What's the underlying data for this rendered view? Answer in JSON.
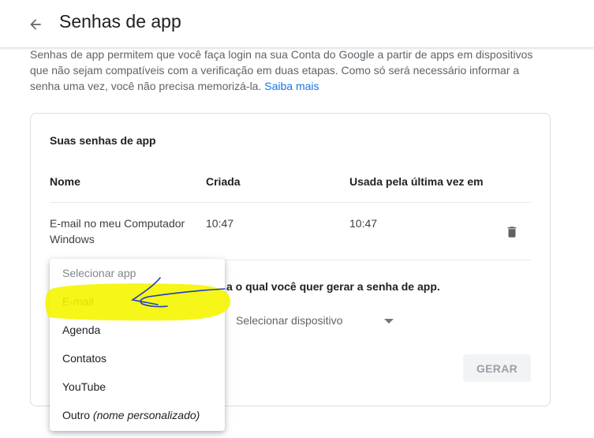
{
  "header": {
    "title": "Senhas de app",
    "back_icon": "arrow-left-icon"
  },
  "intro": {
    "text": "Senhas de app permitem que você faça login na sua Conta do Google a partir de apps em dispositivos que não sejam compatíveis com a verificação em duas etapas. Como só será necessário informar a senha uma vez, você não precisa memorizá-la.",
    "link_label": "Saiba mais"
  },
  "card": {
    "title": "Suas senhas de app",
    "columns": [
      "Nome",
      "Criada",
      "Usada pela última vez em"
    ],
    "rows": [
      {
        "name": "E-mail no meu Computador Windows",
        "created": "10:47",
        "last_used": "10:47",
        "delete_icon": "trash-icon"
      }
    ],
    "generate_instruction_visible": "a o qual você quer gerar a senha de app.",
    "device_select_placeholder": "Selecionar dispositivo",
    "generate_button": "GERAR"
  },
  "dropdown": {
    "placeholder": "Selecionar app",
    "options": [
      "E-mail",
      "Agenda",
      "Contatos",
      "YouTube"
    ],
    "other_prefix": "Outro",
    "other_suffix": "(nome personalizado)",
    "highlight_color": "#f5f500",
    "annotation_color": "#1a3cc8"
  },
  "colors": {
    "link": "#1a73e8",
    "text_primary": "#202124",
    "text_secondary": "#5f6368",
    "border": "#dadce0"
  }
}
